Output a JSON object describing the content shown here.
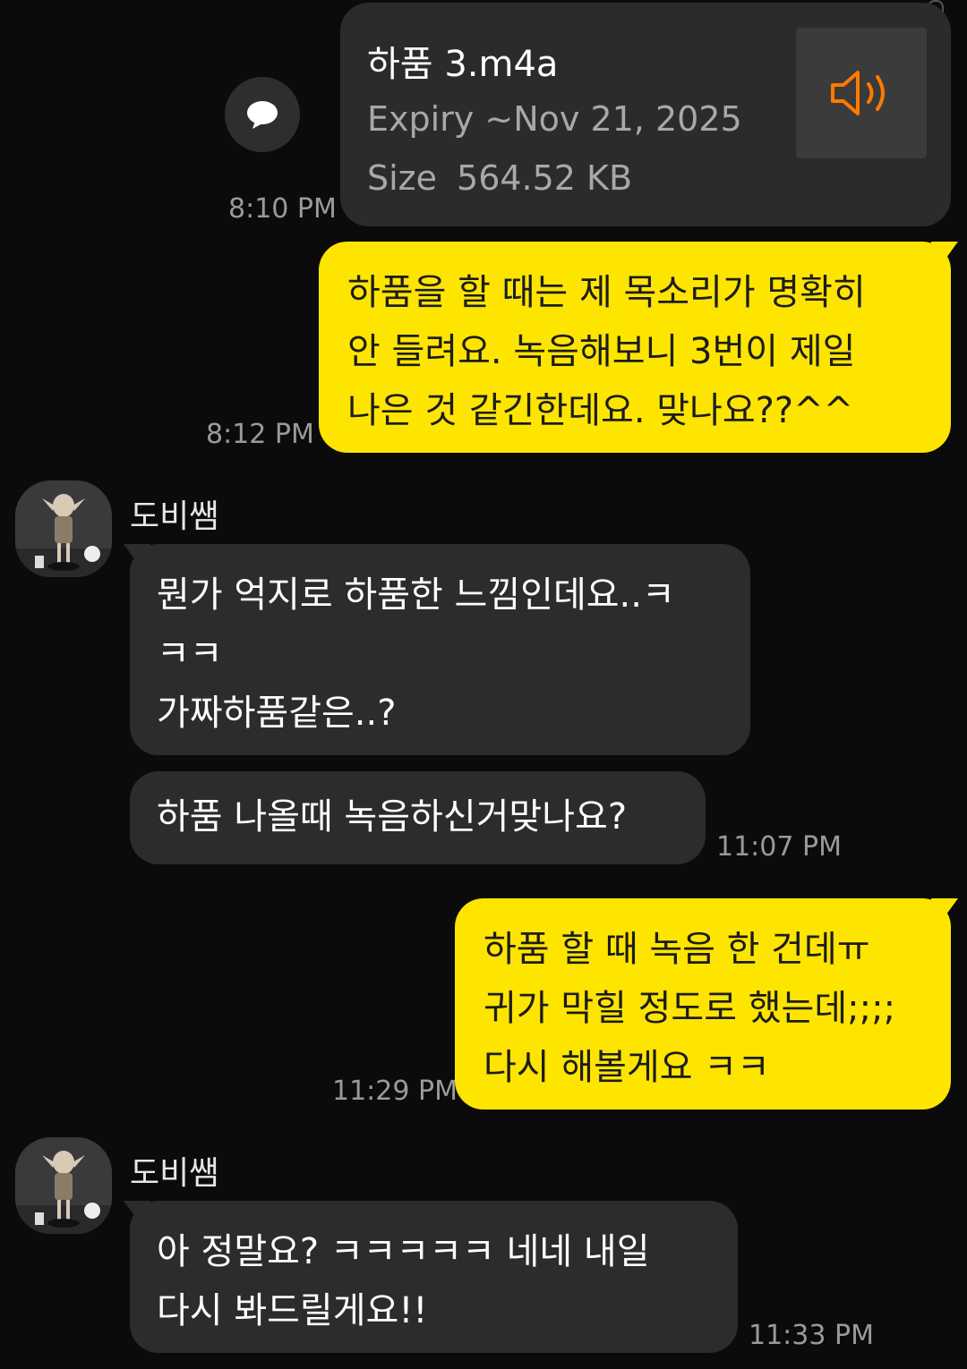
{
  "file_message": {
    "file_name": "하품 3.m4a",
    "expiry_label": "Expiry ~Nov 21, 2025",
    "size_label": "Size",
    "size_value": "564.52 KB",
    "time": "8:10 PM",
    "icons": {
      "audio": "speaker-icon",
      "share": "speech-bubble-icon"
    },
    "accent": "#ff7a00"
  },
  "messages": [
    {
      "id": "m1",
      "from": "me",
      "time": "8:12 PM",
      "lines": [
        "하품을 할 때는 제 목소리가 명확히",
        "안 들려요. 녹음해보니 3번이 제일",
        "나은 것 같긴한데요. 맞나요??^^"
      ]
    },
    {
      "id": "m2",
      "from": "other",
      "sender": "도비쌤",
      "time": "",
      "lines": [
        "뭔가 억지로 하품한 느낌인데요..ㅋ",
        "ㅋㅋ",
        "가짜하품같은..?"
      ]
    },
    {
      "id": "m3",
      "from": "other",
      "time": "11:07 PM",
      "lines": [
        "하품 나올때 녹음하신거맞나요?"
      ]
    },
    {
      "id": "m4",
      "from": "me",
      "time": "11:29 PM",
      "lines": [
        "하품 할 때 녹음 한 건데ㅠ",
        "귀가 막힐 정도로 했는데;;;;",
        "다시 해볼게요 ㅋㅋ"
      ]
    },
    {
      "id": "m5",
      "from": "other",
      "sender": "도비쌤",
      "time": "11:33 PM",
      "lines": [
        "아 정말요? ㅋㅋㅋㅋㅋ 네네 내일",
        "다시 봐드릴게요!!"
      ]
    }
  ],
  "colors": {
    "my_bubble": "#fee500",
    "other_bubble": "#2c2c2c",
    "background": "#0b0b0b",
    "time_text": "#9a9a9a"
  }
}
